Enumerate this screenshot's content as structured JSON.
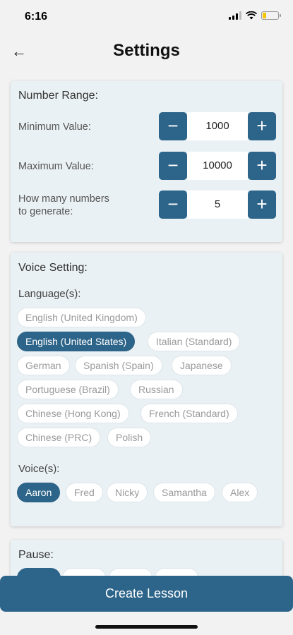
{
  "status_bar": {
    "time": "6:16"
  },
  "header": {
    "title": "Settings",
    "back_icon": "←"
  },
  "number_range": {
    "title": "Number Range:",
    "min_label": "Minimum Value:",
    "min_value": "1000",
    "max_label": "Maximum Value:",
    "max_value": "10000",
    "count_label_line1": "How many numbers",
    "count_label_line2": "to generate:",
    "count_value": "5",
    "minus": "−",
    "plus": "+"
  },
  "voice": {
    "title": "Voice Setting:",
    "languages_label": "Language(s):",
    "languages": [
      "English (United Kingdom)",
      "English (United States)",
      "Italian (Standard)",
      "German",
      "Spanish (Spain)",
      "Japanese",
      "Portuguese (Brazil)",
      "Russian",
      "Chinese (Hong Kong)",
      "French (Standard)",
      "Chinese (PRC)",
      "Polish"
    ],
    "selected_language": "English (United States)",
    "voices_label": "Voice(s):",
    "voices": [
      "Aaron",
      "Fred",
      "Nicky",
      "Samantha",
      "Alex"
    ],
    "selected_voice": "Aaron"
  },
  "pause": {
    "title": "Pause:"
  },
  "footer": {
    "create_label": "Create Lesson"
  },
  "colors": {
    "accent": "#2d6489",
    "card_bg": "#eaf1f4",
    "page_bg": "#f2f2f2"
  }
}
